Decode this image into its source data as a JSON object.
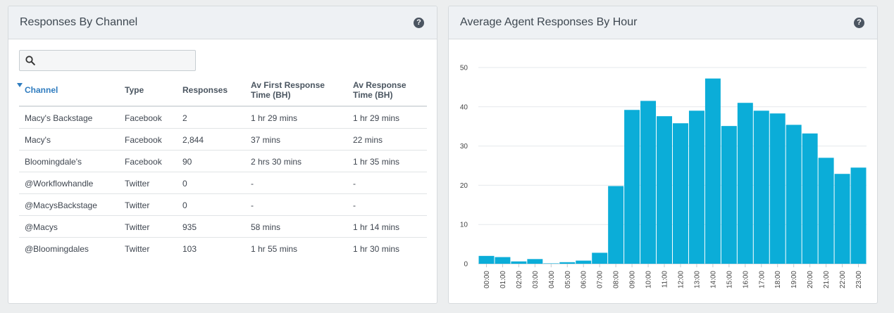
{
  "left_panel": {
    "title": "Responses By Channel",
    "help_icon": "question-circle-icon",
    "search": {
      "placeholder": "",
      "value": "",
      "icon": "search-icon"
    },
    "table": {
      "columns": [
        {
          "line1": "Channel",
          "line2": "",
          "sorted": "descending"
        },
        {
          "line1": "Type",
          "line2": ""
        },
        {
          "line1": "Responses",
          "line2": ""
        },
        {
          "line1": "Av First Response",
          "line2": "Time (BH)"
        },
        {
          "line1": "Av Response",
          "line2": "Time (BH)"
        }
      ],
      "rows": [
        [
          "Macy's Backstage",
          "Facebook",
          "2",
          "1 hr 29 mins",
          "1 hr 29 mins"
        ],
        [
          "Macy's",
          "Facebook",
          "2,844",
          "37 mins",
          "22 mins"
        ],
        [
          "Bloomingdale's",
          "Facebook",
          "90",
          "2 hrs 30 mins",
          "1 hr 35 mins"
        ],
        [
          "@Workflowhandle",
          "Twitter",
          "0",
          "-",
          "-"
        ],
        [
          "@MacysBackstage",
          "Twitter",
          "0",
          "-",
          "-"
        ],
        [
          "@Macys",
          "Twitter",
          "935",
          "58 mins",
          "1 hr 14 mins"
        ],
        [
          "@Bloomingdales",
          "Twitter",
          "103",
          "1 hr 55 mins",
          "1 hr 30 mins"
        ]
      ]
    }
  },
  "right_panel": {
    "title": "Average Agent Responses By Hour",
    "help_icon": "question-circle-icon"
  },
  "colors": {
    "bar": "#0badd8",
    "accent": "#2f7cbf"
  },
  "chart_data": {
    "type": "bar",
    "title": "Average Agent Responses By Hour",
    "xlabel": "",
    "ylabel": "",
    "ylim": [
      0,
      50
    ],
    "yticks": [
      0,
      10,
      20,
      30,
      40,
      50
    ],
    "grid": true,
    "categories": [
      "00:00",
      "01:00",
      "02:00",
      "03:00",
      "04:00",
      "05:00",
      "06:00",
      "07:00",
      "08:00",
      "09:00",
      "10:00",
      "11:00",
      "12:00",
      "13:00",
      "14:00",
      "15:00",
      "16:00",
      "17:00",
      "18:00",
      "19:00",
      "20:00",
      "21:00",
      "22:00",
      "23:00"
    ],
    "values": [
      2,
      1.7,
      0.6,
      1.2,
      0.1,
      0.4,
      0.8,
      2.8,
      19.8,
      39.2,
      41.5,
      37.6,
      35.8,
      39.0,
      47.2,
      35.1,
      41.0,
      39.0,
      38.3,
      35.4,
      33.2,
      27.0,
      22.9,
      24.5
    ]
  }
}
